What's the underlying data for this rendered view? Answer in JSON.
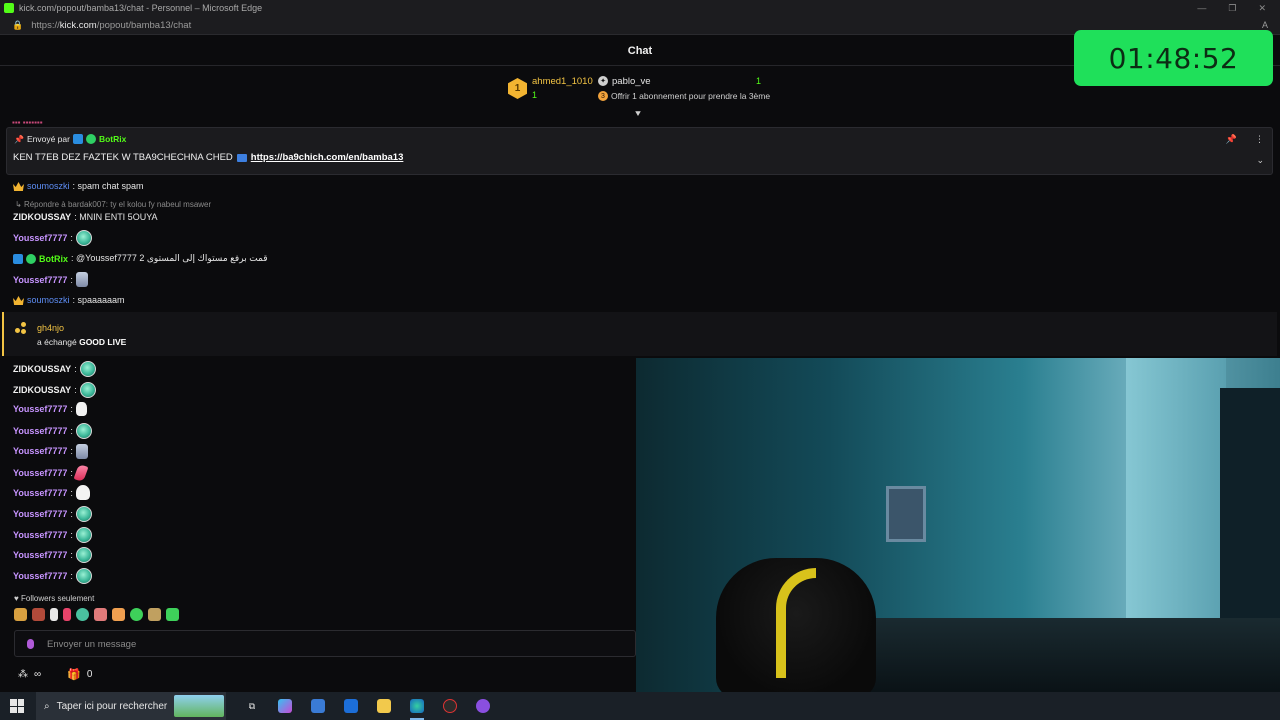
{
  "window": {
    "title": "kick.com/popout/bamba13/chat - Personnel – Microsoft Edge",
    "url_prefix": "https://",
    "url_domain": "kick.com",
    "url_path": "/popout/bamba13/chat",
    "controls": [
      "—",
      "❐",
      "✕"
    ]
  },
  "chat": {
    "title": "Chat"
  },
  "timer": "01:48:52",
  "leaderboard": {
    "rank": "1",
    "top_user": "ahmed1_1010",
    "top_count": "1",
    "second_user": "pablo_ve",
    "second_count": "1",
    "offer_text": "Offrir 1 abonnement pour prendre la 3ème"
  },
  "pinned": {
    "sent_by_label": "Envoyé par",
    "sender": "BotRix",
    "message": "KEN T7EB DEZ FAZTEK W TBA9CHECHNA CHED",
    "link": "https://ba9chich.com/en/bamba13"
  },
  "messages": [
    {
      "user": "soumoszki",
      "text": ": spam chat spam"
    },
    {
      "reply": "Répondre à bardak007: ty el kolou fy nabeul msawer"
    },
    {
      "user": "ZIDKOUSSAY",
      "text": ": MNIN ENTI 5OUYA"
    },
    {
      "user": "Youssef7777",
      "text": ":"
    },
    {
      "user": "BotRix",
      "text": ": @Youssef7777 قمت برفع مستواك إلى المستوى 2"
    },
    {
      "user": "Youssef7777",
      "text": ":"
    },
    {
      "user": "soumoszki",
      "text": ": spaaaaaam"
    }
  ],
  "reward": {
    "user": "gh4njo",
    "prefix": "a échangé",
    "item": "GOOD LIVE"
  },
  "recent": [
    {
      "user": "ZIDKOUSSAY",
      "emote": "globe"
    },
    {
      "user": "ZIDKOUSSAY",
      "emote": "globe"
    },
    {
      "user": "Youssef7777",
      "emote": "ghost"
    },
    {
      "user": "Youssef7777",
      "emote": "globe"
    },
    {
      "user": "Youssef7777",
      "emote": "trash"
    },
    {
      "user": "Youssef7777",
      "emote": "pink"
    },
    {
      "user": "Youssef7777",
      "emote": "mask"
    },
    {
      "user": "Youssef7777",
      "emote": "globe"
    },
    {
      "user": "Youssef7777",
      "emote": "globe"
    },
    {
      "user": "Youssef7777",
      "emote": "globe"
    },
    {
      "user": "Youssef7777",
      "emote": "globe"
    }
  ],
  "followers_only": "Followers seulement",
  "input": {
    "placeholder": "Envoyer un message"
  },
  "footer": {
    "points": "∞",
    "gifts": "0"
  },
  "taskbar": {
    "search_label": "Taper ici pour rechercher"
  },
  "colors": {
    "kick_green": "#53fc18",
    "timer_bg": "#1fe05a",
    "gold": "#f3c444",
    "purple": "#c794ff",
    "blue": "#5d8df4"
  }
}
